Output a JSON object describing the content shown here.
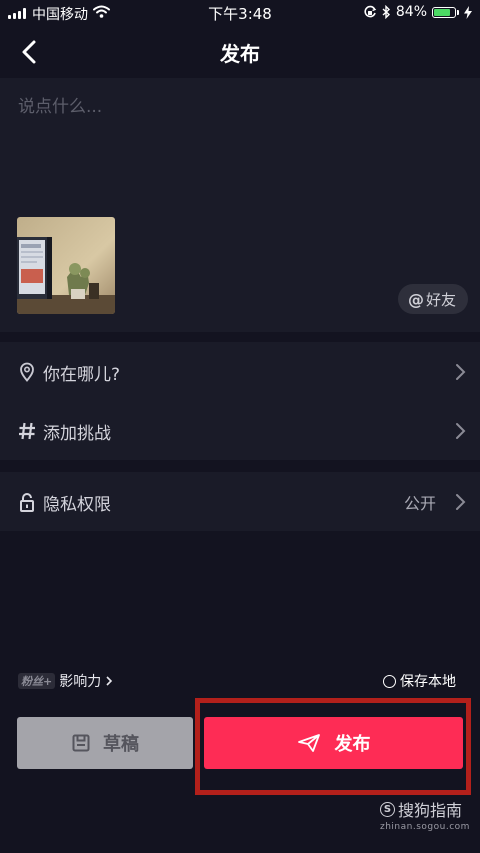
{
  "status_bar": {
    "carrier": "中国移动",
    "time": "下午3:48",
    "battery_percent": "84%",
    "battery_level": 0.84
  },
  "nav": {
    "back_icon": "chevron-left-icon",
    "title": "发布"
  },
  "compose": {
    "caption_placeholder": "说点什么...",
    "mention_at": "@",
    "mention_label": "好友"
  },
  "options": {
    "location_label": "你在哪儿?",
    "challenge_label": "添加挑战",
    "privacy_label": "隐私权限",
    "privacy_value": "公开"
  },
  "bottom": {
    "fans_badge": "粉丝+",
    "influence_label": "影响力",
    "save_local_label": "保存本地",
    "draft_label": "草稿",
    "publish_label": "发布"
  },
  "watermark": {
    "logo_letter": "S",
    "brand": "搜狗指南",
    "url": "zhinan.sogou.com"
  },
  "colors": {
    "background": "#131320",
    "card": "#1a1b28",
    "publish_button": "#fe2c55",
    "draft_button": "#a4a4aa",
    "highlight_box": "#b3201b"
  }
}
